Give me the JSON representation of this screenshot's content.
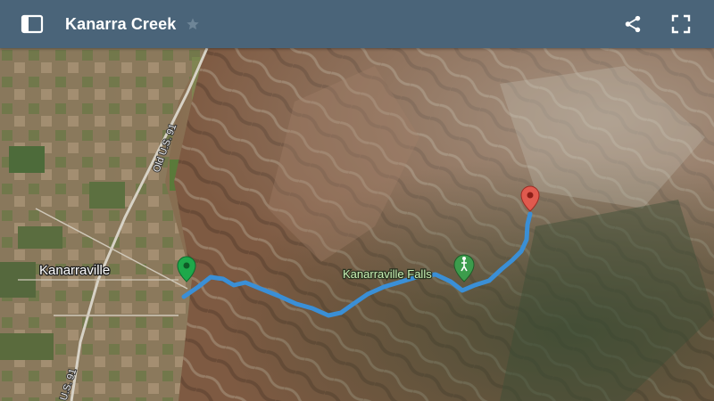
{
  "app": {
    "title": "Kanarra Creek",
    "colors": {
      "header_bg": "#4a6479",
      "route": "#3a8fd6",
      "start_marker": "#1ea84a",
      "end_marker": "#e05a4e",
      "poi_marker": "#3c9c4c"
    },
    "icons": {
      "menu": "sidebar-toggle-icon",
      "star": "star-outline-icon",
      "share": "share-icon",
      "fullscreen": "fullscreen-icon"
    }
  },
  "map": {
    "type": "satellite",
    "labels": {
      "town": "Kanarraville",
      "poi": "Kanarraville Falls",
      "road_top": "Old U.S. 91",
      "road_bottom": "U.S. 91"
    },
    "markers": [
      "start-marker",
      "end-marker",
      "hiking-poi-marker"
    ]
  }
}
